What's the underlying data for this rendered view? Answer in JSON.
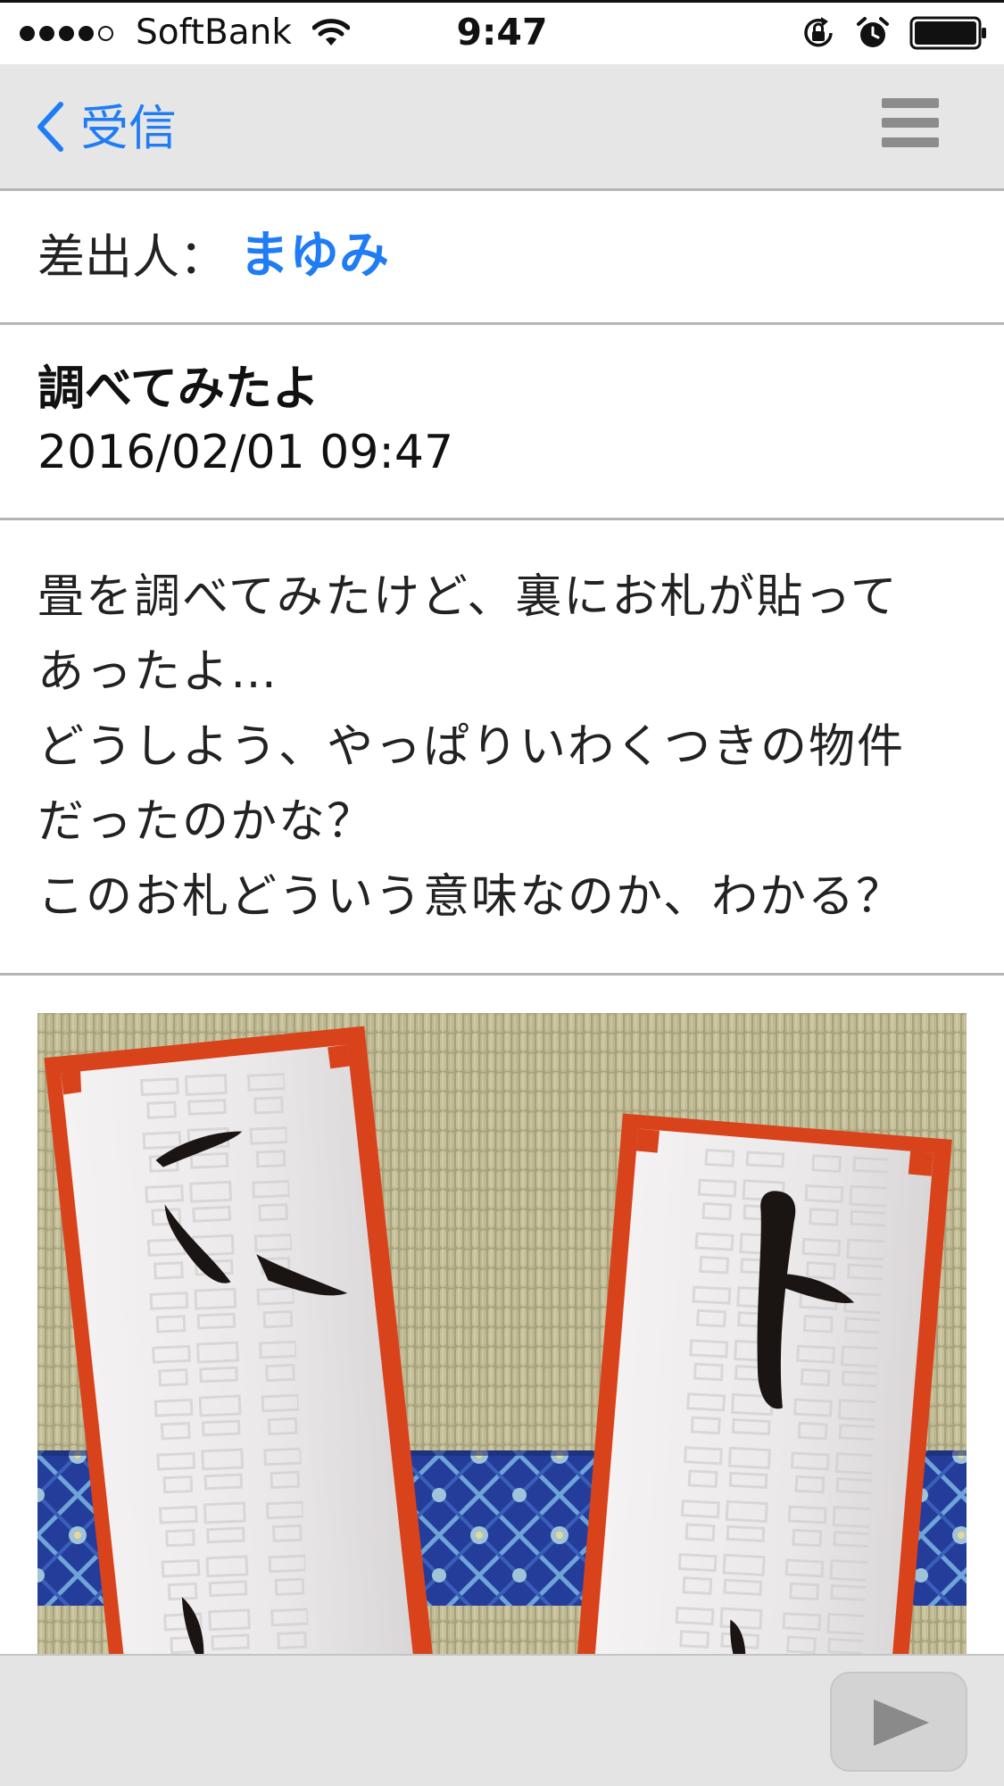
{
  "status_bar": {
    "carrier": "SoftBank",
    "time": "9:47",
    "signal_bars": 4,
    "signal_max": 5,
    "icons": [
      "signal-dots",
      "wifi-icon",
      "rotation-lock-icon",
      "alarm-icon",
      "battery-icon"
    ],
    "battery_level": 1.0
  },
  "nav": {
    "back_label": "受信",
    "back_icon": "chevron-left-icon",
    "menu_icon": "hamburger-menu-icon"
  },
  "message": {
    "sender_label": "差出人：",
    "sender_name": "まゆみ",
    "subject": "調べてみたよ",
    "date": "2016/02/01 09:47",
    "body_lines": [
      "畳を調べてみたけど、裏にお札が貼って",
      "あったよ…",
      "どうしよう、やっぱりいわくつきの物件",
      "だったのかな？",
      "このお札どういう意味なのか、わかる？"
    ]
  },
  "attachment": {
    "description_icon": "attached-photo"
  },
  "toolbar": {
    "play_icon": "play-icon"
  },
  "colors": {
    "accent": "#1f7cf5",
    "nav_background": "#e6e6e6",
    "divider": "#b5b5b5",
    "toolbar_background": "#e4e4e4",
    "talisman_border": "#d8431c"
  }
}
